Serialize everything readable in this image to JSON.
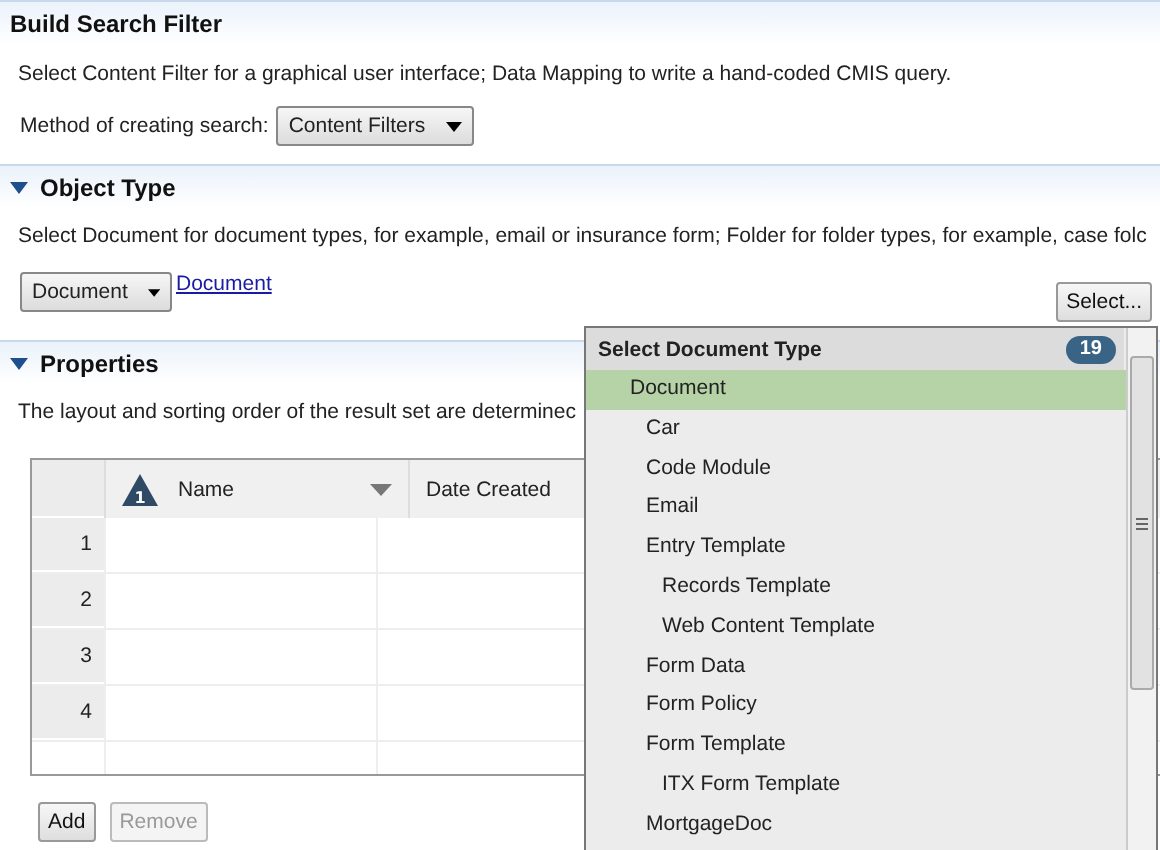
{
  "sections": [
    {
      "title": "Build Search Filter",
      "description": "Select Content Filter for a graphical user interface; Data Mapping to write a hand-coded CMIS query.",
      "method_label": "Method of creating search:",
      "method_value": "Content Filters"
    },
    {
      "title": "Object Type",
      "expanded": true,
      "description": "Select Document for document types, for example, email or insurance form; Folder for folder types, for example, case folc",
      "type_value": "Document",
      "type_link": "Document",
      "select_button": "Select..."
    },
    {
      "title": "Properties",
      "expanded": true,
      "description": "The layout and sorting order of the result set are determinec"
    }
  ],
  "table": {
    "columns": [
      {
        "label": "Name",
        "warning_count": "1"
      },
      {
        "label": "Date Created"
      }
    ],
    "rows": [
      "1",
      "2",
      "3",
      "4"
    ]
  },
  "buttons": [
    {
      "label": "Add",
      "disabled": false
    },
    {
      "label": "Remove",
      "disabled": true
    }
  ],
  "popup": {
    "title": "Select Document Type",
    "count": "19",
    "items": [
      {
        "label": "Document",
        "selected": true,
        "children": [
          {
            "label": "Car",
            "selected": false
          },
          {
            "label": "Code Module",
            "selected": false
          },
          {
            "label": "Email",
            "selected": false
          },
          {
            "label": "Entry Template",
            "selected": false,
            "children": [
              {
                "label": "Records Template",
                "selected": false
              },
              {
                "label": "Web Content Template",
                "selected": false
              }
            ]
          },
          {
            "label": "Form Data",
            "selected": false
          },
          {
            "label": "Form Policy",
            "selected": false
          },
          {
            "label": "Form Template",
            "selected": false,
            "children": [
              {
                "label": "ITX Form Template",
                "selected": false
              }
            ]
          },
          {
            "label": "MortgageDoc",
            "selected": false
          }
        ]
      }
    ]
  }
}
